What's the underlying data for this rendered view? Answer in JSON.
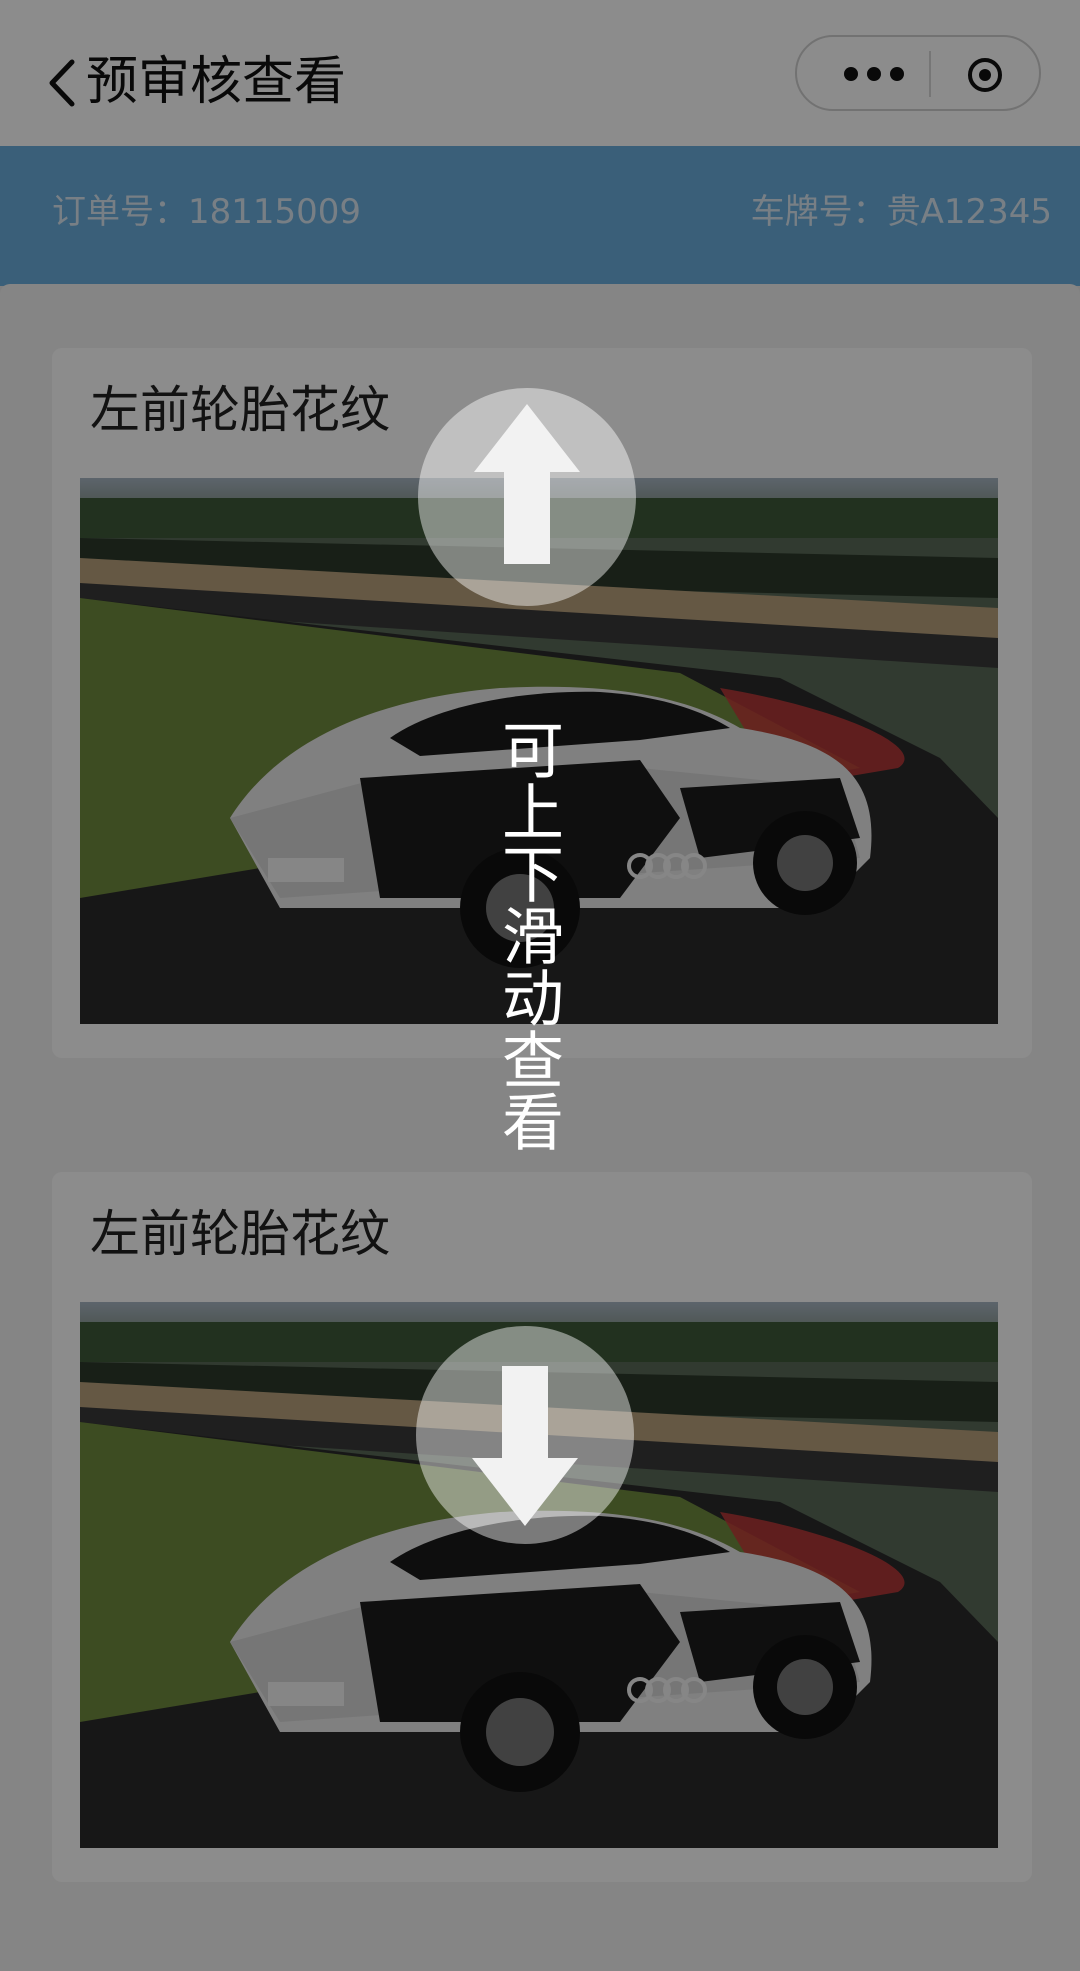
{
  "nav": {
    "title": "预审核查看",
    "back_icon": "chevron-left-icon",
    "more_icon": "more-dots-icon",
    "close_icon": "target-close-icon"
  },
  "info": {
    "order": "订单号：18115009",
    "plate": "车牌号：贵A12345"
  },
  "cards": [
    {
      "label": "左前轮胎花纹",
      "image": "car-photo"
    },
    {
      "label": "左前轮胎花纹",
      "image": "car-photo"
    }
  ],
  "overlay": {
    "hint": "可上下滑动查看",
    "up_icon": "arrow-up-icon",
    "down_icon": "arrow-down-icon"
  },
  "colors": {
    "accent": "#6aaedc",
    "overlay": "rgba(0,0,0,0.45)"
  }
}
